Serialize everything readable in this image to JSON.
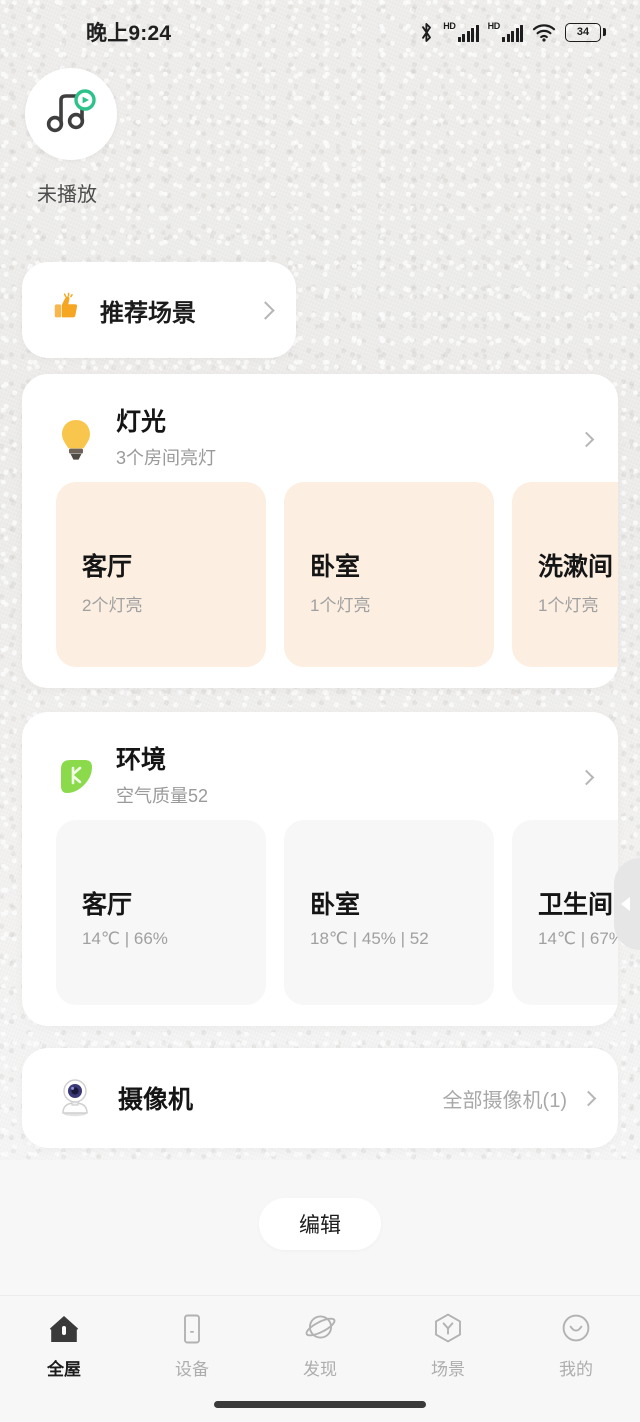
{
  "status_bar": {
    "time": "晚上9:24",
    "battery_level": "34",
    "icons": [
      "bluetooth-icon",
      "signal-hd-1-icon",
      "signal-hd-2-icon",
      "wifi-icon",
      "battery-icon"
    ],
    "hd_label_1": "HD",
    "hd_label_2": "HD"
  },
  "music_widget": {
    "icon": "music-note-icon",
    "badge_icon": "play-badge-icon",
    "status_label": "未播放",
    "badge_color": "#2ec28b"
  },
  "recommend_card": {
    "icon": "thumbs-up-icon",
    "label": "推荐场景",
    "chevron": "chevron-right-icon"
  },
  "lights_card": {
    "icon": "light-bulb-icon",
    "title": "灯光",
    "subtitle": "3个房间亮灯",
    "chevron": "chevron-right-icon",
    "tile_color": "#fceee1",
    "rooms": [
      {
        "name": "客厅",
        "status": "2个灯亮"
      },
      {
        "name": "卧室",
        "status": "1个灯亮"
      },
      {
        "name": "洗漱间",
        "status": "1个灯亮"
      }
    ]
  },
  "environment_card": {
    "icon": "green-leaf-icon",
    "title": "环境",
    "subtitle": "空气质量52",
    "chevron": "chevron-right-icon",
    "tile_color": "#f7f7f7",
    "rooms": [
      {
        "name": "客厅",
        "readings": "14℃ | 66%"
      },
      {
        "name": "卧室",
        "readings": "18℃ | 45% | 52"
      },
      {
        "name": "卫生间",
        "readings": "14℃ | 67%"
      }
    ]
  },
  "side_handle": {
    "icon": "triangle-left-icon"
  },
  "camera_card": {
    "icon": "security-camera-icon",
    "title": "摄像机",
    "right_label": "全部摄像机(1)",
    "chevron": "chevron-right-icon"
  },
  "edit_button": {
    "label": "编辑"
  },
  "bottom_nav": {
    "items": [
      {
        "label": "全屋",
        "icon": "home-icon",
        "active": true
      },
      {
        "label": "设备",
        "icon": "device-tablet-icon",
        "active": false
      },
      {
        "label": "发现",
        "icon": "planet-icon",
        "active": false
      },
      {
        "label": "场景",
        "icon": "hexagon-scene-icon",
        "active": false
      },
      {
        "label": "我的",
        "icon": "smiley-profile-icon",
        "active": false
      }
    ]
  }
}
